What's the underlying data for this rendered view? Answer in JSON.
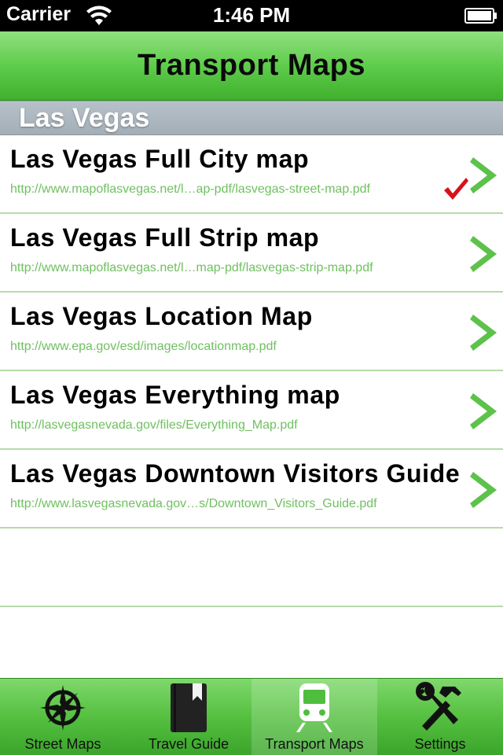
{
  "status_bar": {
    "carrier": "Carrier",
    "time": "1:46 PM",
    "wifi_icon": "wifi-icon",
    "battery_icon": "battery-icon"
  },
  "nav_bar": {
    "title": "Transport Maps"
  },
  "section": {
    "title": "Las Vegas"
  },
  "rows": [
    {
      "title": "Las Vegas Full City map",
      "url": "http://www.mapoflasvegas.net/l…ap-pdf/lasvegas-street-map.pdf",
      "checked": true
    },
    {
      "title": "Las Vegas Full Strip map",
      "url": "http://www.mapoflasvegas.net/l…map-pdf/lasvegas-strip-map.pdf",
      "checked": false
    },
    {
      "title": "Las Vegas Location Map",
      "url": "http://www.epa.gov/esd/images/locationmap.pdf",
      "checked": false
    },
    {
      "title": "Las Vegas Everything map",
      "url": "http://lasvegasnevada.gov/files/Everything_Map.pdf",
      "checked": false
    },
    {
      "title": "Las Vegas Downtown Visitors Guide",
      "url": "http://www.lasvegasnevada.gov…s/Downtown_Visitors_Guide.pdf",
      "checked": false
    }
  ],
  "tab_bar": {
    "tabs": [
      {
        "label": "Street Maps",
        "icon": "compass-icon",
        "selected": false
      },
      {
        "label": "Travel Guide",
        "icon": "book-icon",
        "selected": false
      },
      {
        "label": "Transport Maps",
        "icon": "train-icon",
        "selected": true
      },
      {
        "label": "Settings",
        "icon": "tools-icon",
        "selected": false
      }
    ]
  },
  "colors": {
    "accent_green": "#5fcc4c",
    "url_green": "#6fc060",
    "chevron_green": "#5cc24a",
    "check_red": "#d8121b",
    "separator_green": "#b6dba9"
  }
}
